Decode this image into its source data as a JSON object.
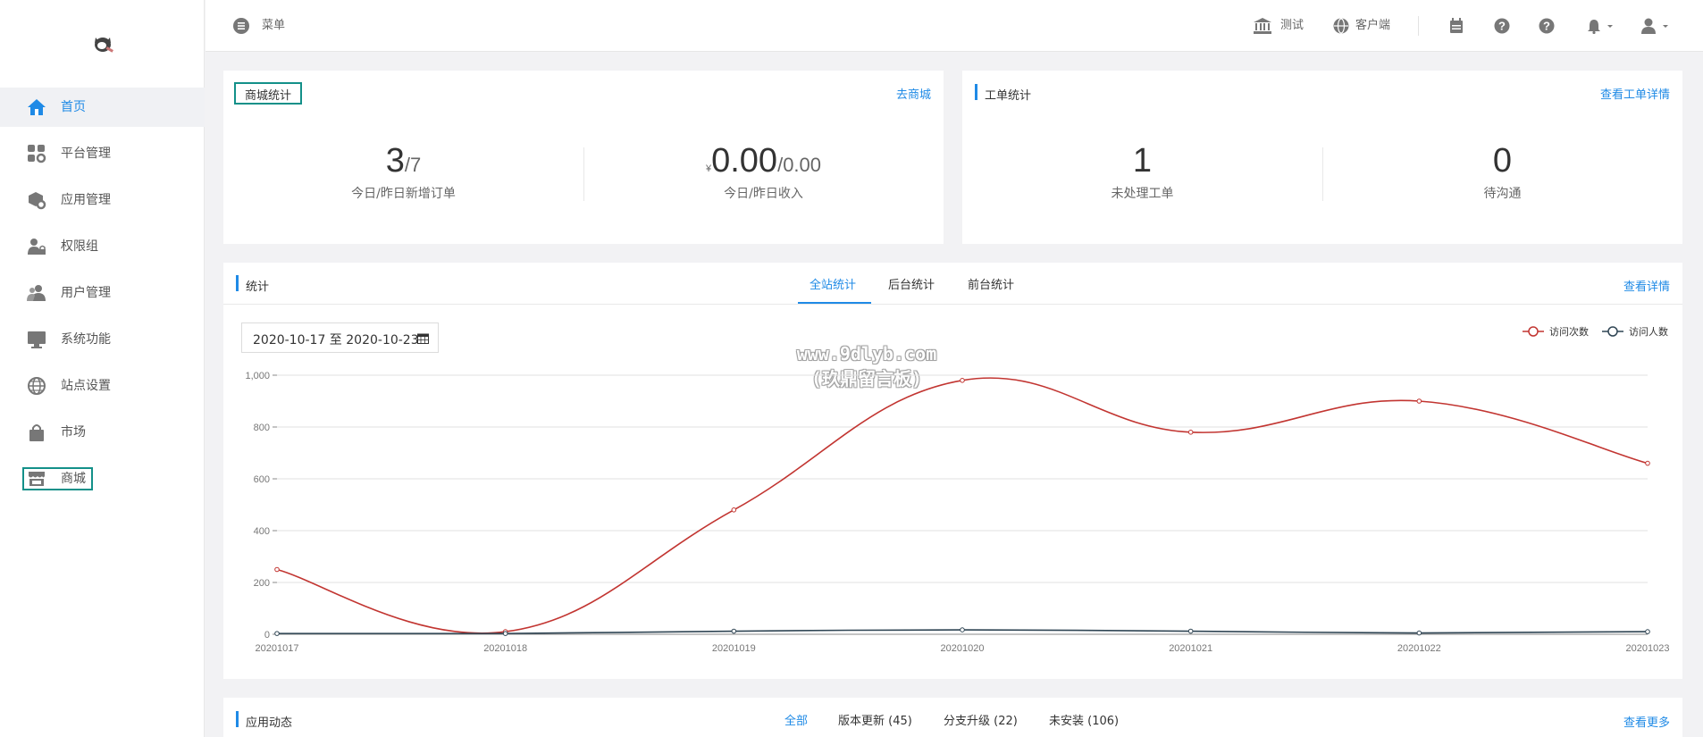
{
  "sidebar": {
    "items": [
      {
        "label": "首页",
        "icon": "home-icon",
        "active": true
      },
      {
        "label": "平台管理",
        "icon": "grid-gear-icon"
      },
      {
        "label": "应用管理",
        "icon": "cube-gear-icon"
      },
      {
        "label": "权限组",
        "icon": "user-lock-icon"
      },
      {
        "label": "用户管理",
        "icon": "users-icon"
      },
      {
        "label": "系统功能",
        "icon": "monitor-icon"
      },
      {
        "label": "站点设置",
        "icon": "globe-icon"
      },
      {
        "label": "市场",
        "icon": "bag-icon"
      },
      {
        "label": "商城",
        "icon": "store-icon"
      }
    ]
  },
  "header": {
    "menu_label": "菜单",
    "test_label": "测试",
    "client_label": "客户端"
  },
  "mall_card": {
    "title": "商城统计",
    "link": "去商城",
    "orders_today": "3",
    "orders_yesterday": "/7",
    "orders_label": "今日/昨日新增订单",
    "currency": "¥",
    "income_today": "0.00",
    "income_yesterday": "/0.00",
    "income_label": "今日/昨日收入"
  },
  "ticket_card": {
    "title": "工单统计",
    "link": "查看工单详情",
    "unprocessed": "1",
    "unprocessed_label": "未处理工单",
    "pending": "0",
    "pending_label": "待沟通"
  },
  "stats_card": {
    "title": "统计",
    "tabs": [
      "全站统计",
      "后台统计",
      "前台统计"
    ],
    "link": "查看详情",
    "date_range": "2020-10-17 至 2020-10-23",
    "watermark_line1": "www.9dlyb.com",
    "watermark_line2": "(玖鼎留言板)"
  },
  "chart_data": {
    "type": "line",
    "x": [
      "20201017",
      "20201018",
      "20201019",
      "20201020",
      "20201021",
      "20201022",
      "20201023"
    ],
    "series": [
      {
        "name": "访问次数",
        "values": [
          250,
          10,
          480,
          980,
          780,
          900,
          660
        ],
        "color": "#c23531"
      },
      {
        "name": "访问人数",
        "values": [
          3,
          3,
          12,
          17,
          12,
          5,
          10
        ],
        "color": "#2f4554"
      }
    ],
    "yticks": [
      "0",
      "200",
      "400",
      "600",
      "800",
      "1,000"
    ],
    "ylim": [
      0,
      1000
    ],
    "grid": true,
    "legend": "top-right",
    "smooth": true
  },
  "apps_card": {
    "title": "应用动态",
    "tabs": [
      "全部",
      "版本更新 (45)",
      "分支升级 (22)",
      "未安装 (106)"
    ],
    "link": "查看更多"
  },
  "colors": {
    "accent": "#1f8ae6",
    "highlight": "#139089"
  }
}
